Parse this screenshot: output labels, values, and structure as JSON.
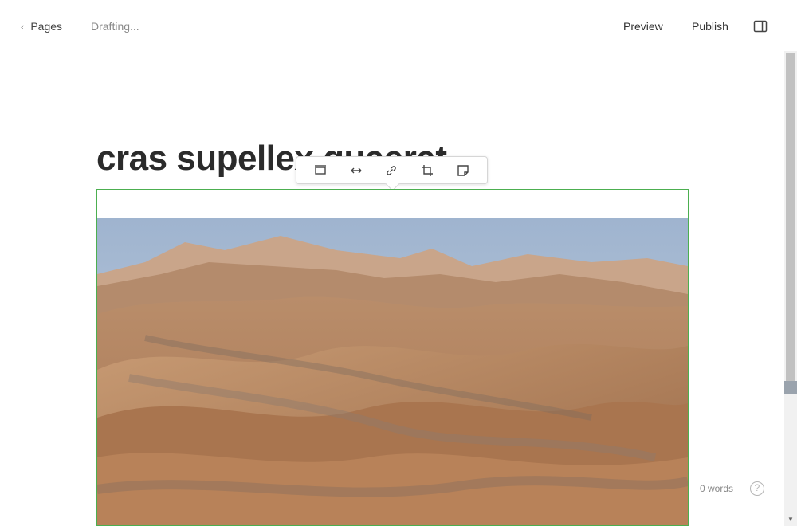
{
  "header": {
    "back_label": "Pages",
    "status": "Drafting...",
    "preview_label": "Preview",
    "publish_label": "Publish",
    "back_icon": "chevron-left-icon",
    "panel_icon": "sidebar-panel-icon"
  },
  "editor": {
    "title": "cras supellex quaerat",
    "image_toolbar": {
      "tools": [
        "align-icon",
        "wide-width-icon",
        "link-icon",
        "crop-icon",
        "caption-icon"
      ]
    },
    "image": {
      "description_icon": "desert-dunes-photo"
    }
  },
  "footer": {
    "word_count": "0 words",
    "help_label": "?"
  },
  "colors": {
    "selection_border": "#4caf50",
    "text": "#1e1e1e",
    "muted": "#8a8a8a"
  }
}
